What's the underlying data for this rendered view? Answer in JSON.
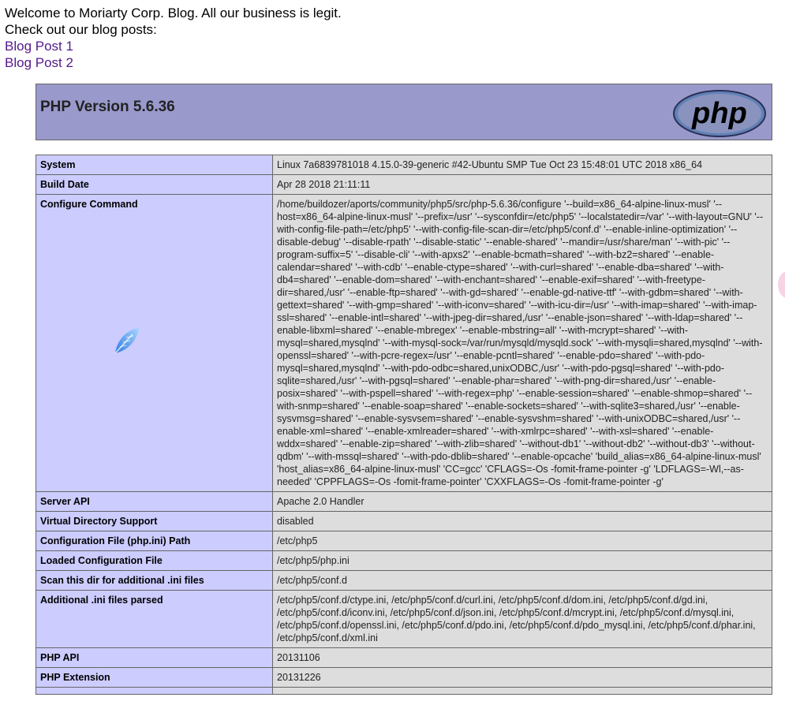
{
  "intro": {
    "line1": "Welcome to Moriarty Corp. Blog. All our business is legit.",
    "line2": "Check out our blog posts:",
    "links": [
      "Blog Post 1",
      "Blog Post 2"
    ]
  },
  "phpinfo": {
    "title": "PHP Version 5.6.36",
    "logo_text": "php",
    "rows": [
      {
        "label": "System",
        "value": "Linux 7a6839781018 4.15.0-39-generic #42-Ubuntu SMP Tue Oct 23 15:48:01 UTC 2018 x86_64"
      },
      {
        "label": "Build Date",
        "value": "Apr 28 2018 21:11:11"
      },
      {
        "label": "Configure Command",
        "value": "/home/buildozer/aports/community/php5/src/php-5.6.36/configure '--build=x86_64-alpine-linux-musl' '--host=x86_64-alpine-linux-musl' '--prefix=/usr' '--sysconfdir=/etc/php5' '--localstatedir=/var' '--with-layout=GNU' '--with-config-file-path=/etc/php5' '--with-config-file-scan-dir=/etc/php5/conf.d' '--enable-inline-optimization' '--disable-debug' '--disable-rpath' '--disable-static' '--enable-shared' '--mandir=/usr/share/man' '--with-pic' '--program-suffix=5' '--disable-cli' '--with-apxs2' '--enable-bcmath=shared' '--with-bz2=shared' '--enable-calendar=shared' '--with-cdb' '--enable-ctype=shared' '--with-curl=shared' '--enable-dba=shared' '--with-db4=shared' '--enable-dom=shared' '--with-enchant=shared' '--enable-exif=shared' '--with-freetype-dir=shared,/usr' '--enable-ftp=shared' '--with-gd=shared' '--enable-gd-native-ttf' '--with-gdbm=shared' '--with-gettext=shared' '--with-gmp=shared' '--with-iconv=shared' '--with-icu-dir=/usr' '--with-imap=shared' '--with-imap-ssl=shared' '--enable-intl=shared' '--with-jpeg-dir=shared,/usr' '--enable-json=shared' '--with-ldap=shared' '--enable-libxml=shared' '--enable-mbregex' '--enable-mbstring=all' '--with-mcrypt=shared' '--with-mysql=shared,mysqlnd' '--with-mysql-sock=/var/run/mysqld/mysqld.sock' '--with-mysqli=shared,mysqlnd' '--with-openssl=shared' '--with-pcre-regex=/usr' '--enable-pcntl=shared' '--enable-pdo=shared' '--with-pdo-mysql=shared,mysqlnd' '--with-pdo-odbc=shared,unixODBC,/usr' '--with-pdo-pgsql=shared' '--with-pdo-sqlite=shared,/usr' '--with-pgsql=shared' '--enable-phar=shared' '--with-png-dir=shared,/usr' '--enable-posix=shared' '--with-pspell=shared' '--with-regex=php' '--enable-session=shared' '--enable-shmop=shared' '--with-snmp=shared' '--enable-soap=shared' '--enable-sockets=shared' '--with-sqlite3=shared,/usr' '--enable-sysvmsg=shared' '--enable-sysvsem=shared' '--enable-sysvshm=shared' '--with-unixODBC=shared,/usr' '--enable-xml=shared' '--enable-xmlreader=shared' '--with-xmlrpc=shared' '--with-xsl=shared' '--enable-wddx=shared' '--enable-zip=shared' '--with-zlib=shared' '--without-db1' '--without-db2' '--without-db3' '--without-qdbm' '--with-mssql=shared' '--with-pdo-dblib=shared' '--enable-opcache' 'build_alias=x86_64-alpine-linux-musl' 'host_alias=x86_64-alpine-linux-musl' 'CC=gcc' 'CFLAGS=-Os -fomit-frame-pointer -g' 'LDFLAGS=-Wl,--as-needed' 'CPPFLAGS=-Os -fomit-frame-pointer' 'CXXFLAGS=-Os -fomit-frame-pointer -g'"
      },
      {
        "label": "Server API",
        "value": "Apache 2.0 Handler"
      },
      {
        "label": "Virtual Directory Support",
        "value": "disabled"
      },
      {
        "label": "Configuration File (php.ini) Path",
        "value": "/etc/php5"
      },
      {
        "label": "Loaded Configuration File",
        "value": "/etc/php5/php.ini"
      },
      {
        "label": "Scan this dir for additional .ini files",
        "value": "/etc/php5/conf.d"
      },
      {
        "label": "Additional .ini files parsed",
        "value": "/etc/php5/conf.d/ctype.ini, /etc/php5/conf.d/curl.ini, /etc/php5/conf.d/dom.ini, /etc/php5/conf.d/gd.ini, /etc/php5/conf.d/iconv.ini, /etc/php5/conf.d/json.ini, /etc/php5/conf.d/mcrypt.ini, /etc/php5/conf.d/mysql.ini, /etc/php5/conf.d/openssl.ini, /etc/php5/conf.d/pdo.ini, /etc/php5/conf.d/pdo_mysql.ini, /etc/php5/conf.d/phar.ini, /etc/php5/conf.d/xml.ini"
      },
      {
        "label": "PHP API",
        "value": "20131106"
      },
      {
        "label": "PHP Extension",
        "value": "20131226"
      },
      {
        "label": "",
        "value": ""
      }
    ]
  },
  "colors": {
    "header_bg": "#9999cc",
    "label_bg": "#ccccff",
    "value_bg": "#dddddd",
    "link": "#551a8b"
  },
  "icons": {
    "logo": "php-logo",
    "spinner": "feather-loading-icon"
  }
}
